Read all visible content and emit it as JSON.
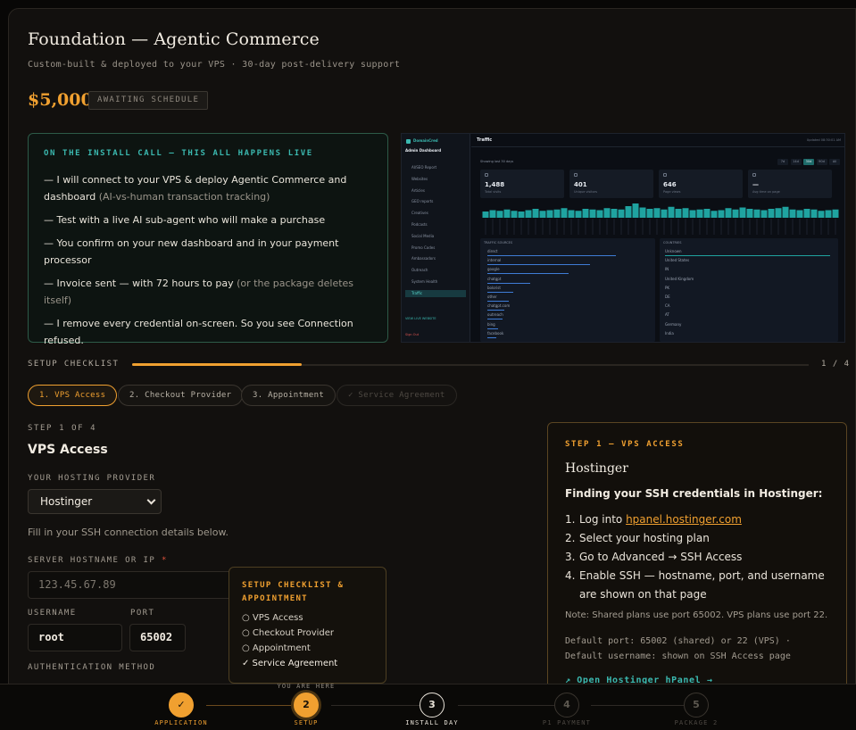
{
  "header": {
    "title": "Foundation — Agentic Commerce",
    "subtitle": "Custom-built & deployed to your VPS · 30-day post-delivery support",
    "price": "$5,000",
    "status": "AWAITING SCHEDULE"
  },
  "install_call": {
    "heading": "ON THE INSTALL CALL — THIS ALL HAPPENS LIVE",
    "items": [
      {
        "text": "— I will connect to your VPS & deploy Agentic Commerce and dashboard",
        "muted": "(AI-vs-human transaction tracking)"
      },
      {
        "text": "— Test with a live AI sub-agent who will make a purchase",
        "muted": ""
      },
      {
        "text": "— You confirm on your new dashboard and in your payment processor",
        "muted": ""
      },
      {
        "text": "— Invoice sent — with 72 hours to pay",
        "muted": "(or the package deletes itself)"
      },
      {
        "text": "— I remove every credential on-screen. So you see Connection refused.",
        "muted": ""
      }
    ]
  },
  "dashboard_preview": {
    "brand": "DomainCred",
    "section": "Admin Dashboard",
    "page_title": "Traffic",
    "updated": "Updated 08:30:01 AM",
    "range_label": "Showing last 30 days",
    "range_buttons": [
      "7d",
      "14d",
      "30d",
      "90d",
      "All"
    ],
    "nav": [
      "AI/SEO Report",
      "Websites",
      "Articles",
      "GEO reports",
      "Creatives",
      "Podcasts",
      "Social Media",
      "Promo Codes",
      "Ambassadors",
      "Outreach",
      "System Health",
      "Traffic"
    ],
    "footer_items": [
      "VIEW LIVE WEBSITE",
      "Sign Out"
    ],
    "stats": [
      {
        "value": "1,488",
        "label": "Total visits"
      },
      {
        "value": "401",
        "label": "Unique visitors"
      },
      {
        "value": "646",
        "label": "Page views"
      },
      {
        "value": "—",
        "label": "Avg time on page"
      }
    ],
    "bars": [
      4,
      6,
      5,
      7,
      5,
      4,
      6,
      8,
      5,
      6,
      7,
      9,
      6,
      5,
      8,
      7,
      6,
      9,
      8,
      7,
      12,
      16,
      10,
      8,
      9,
      7,
      11,
      8,
      9,
      6,
      7,
      8,
      5,
      6,
      9,
      7,
      10,
      8,
      7,
      6,
      8,
      9,
      11,
      7,
      6,
      8,
      7,
      5,
      6,
      7
    ],
    "sources_title": "TRAFFIC SOURCES",
    "sources": [
      {
        "name": "direct",
        "w": 60
      },
      {
        "name": "internal",
        "w": 48
      },
      {
        "name": "google",
        "w": 38
      },
      {
        "name": "chatgpt",
        "w": 20
      },
      {
        "name": "bolorist",
        "w": 12
      },
      {
        "name": "other",
        "w": 10
      },
      {
        "name": "chatgpt.com",
        "w": 8
      },
      {
        "name": "outreach",
        "w": 7
      },
      {
        "name": "bing",
        "w": 5
      },
      {
        "name": "facebook",
        "w": 4
      }
    ],
    "countries_title": "COUNTRIES",
    "countries": [
      "Unknown",
      "United States",
      "IN",
      "United Kingdom",
      "PK",
      "DE",
      "CA",
      "AT",
      "Germany",
      "India"
    ]
  },
  "checklist": {
    "label": "SETUP CHECKLIST",
    "count": "1 / 4",
    "progress": 0.25,
    "tabs": [
      {
        "label": "1. VPS Access",
        "state": "active"
      },
      {
        "label": "2. Checkout Provider",
        "state": "todo"
      },
      {
        "label": "3. Appointment",
        "state": "todo"
      },
      {
        "label": "✓ Service Agreement",
        "state": "done"
      }
    ]
  },
  "form": {
    "step_label": "STEP 1 OF 4",
    "title": "VPS Access",
    "provider_label": "YOUR HOSTING PROVIDER",
    "provider_value": "Hostinger",
    "helper": "Fill in your SSH connection details below.",
    "hostname_label": "SERVER HOSTNAME OR IP",
    "hostname_required": "*",
    "hostname_placeholder": "123.45.67.89",
    "username_label": "USERNAME",
    "username_value": "root",
    "port_label": "PORT",
    "port_value": "65002",
    "auth_label": "AUTHENTICATION METHOD"
  },
  "tooltip": {
    "title": "SETUP CHECKLIST & APPOINTMENT",
    "items": [
      "○ VPS Access",
      "○ Checkout Provider",
      "○ Appointment",
      "✓ Service Agreement"
    ]
  },
  "guide": {
    "heading": "STEP 1 — VPS ACCESS",
    "provider": "Hostinger",
    "subtitle": "Finding your SSH credentials in Hostinger:",
    "steps": [
      {
        "num": "1.",
        "text": "Log into ",
        "link": "hpanel.hostinger.com"
      },
      {
        "num": "2.",
        "text": "Select your hosting plan",
        "link": ""
      },
      {
        "num": "3.",
        "text": "Go to Advanced → SSH Access",
        "link": ""
      },
      {
        "num": "4.",
        "text": "Enable SSH — hostname, port, and username are shown on that page",
        "link": ""
      }
    ],
    "note": "Note: Shared plans use port 65002. VPS plans use port 22.",
    "default_port": "Default port: 65002 (shared) or 22 (VPS) · Default username: shown on SSH Access page",
    "open_link": "↗ Open Hostinger hPanel →"
  },
  "progress_steps": {
    "you_are_here": "YOU ARE HERE",
    "steps": [
      {
        "symbol": "✓",
        "label": "APPLICATION",
        "state": "done"
      },
      {
        "symbol": "2",
        "label": "SETUP",
        "state": "current"
      },
      {
        "symbol": "3",
        "label": "INSTALL DAY",
        "state": "upcoming"
      },
      {
        "symbol": "4",
        "label": "P1 PAYMENT",
        "state": "future"
      },
      {
        "symbol": "5",
        "label": "PACKAGE 2",
        "state": "future"
      }
    ]
  },
  "colors": {
    "accent": "#f0a030",
    "teal": "#3bb9b0",
    "background": "#12100e"
  }
}
